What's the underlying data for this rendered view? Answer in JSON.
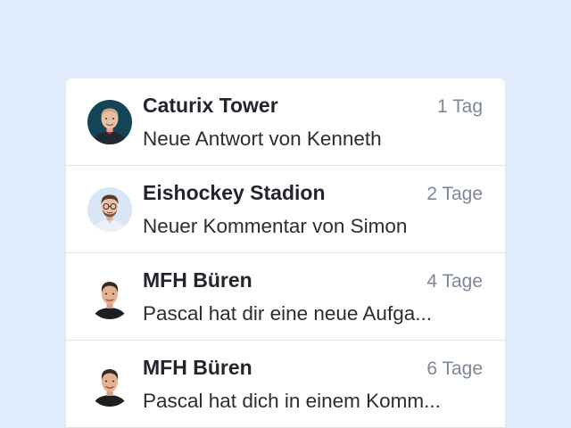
{
  "notifications": [
    {
      "title": "Caturix Tower",
      "time": "1 Tag",
      "message": "Neue Antwort von Kenneth",
      "avatar_icon": "avatar-kenneth-icon"
    },
    {
      "title": "Eishockey Stadion",
      "time": "2 Tage",
      "message": "Neuer Kommentar von Simon",
      "avatar_icon": "avatar-simon-icon"
    },
    {
      "title": "MFH Büren",
      "time": "4 Tage",
      "message": "Pascal hat dir eine neue Aufga...",
      "avatar_icon": "avatar-pascal-icon"
    },
    {
      "title": "MFH Büren",
      "time": "6 Tage",
      "message": "Pascal hat dich in einem Komm...",
      "avatar_icon": "avatar-pascal-icon"
    }
  ],
  "colors": {
    "background": "#e1edfd",
    "card": "#ffffff",
    "title_text": "#22252b",
    "time_text": "#7c8797",
    "divider": "#e2e6ec"
  }
}
